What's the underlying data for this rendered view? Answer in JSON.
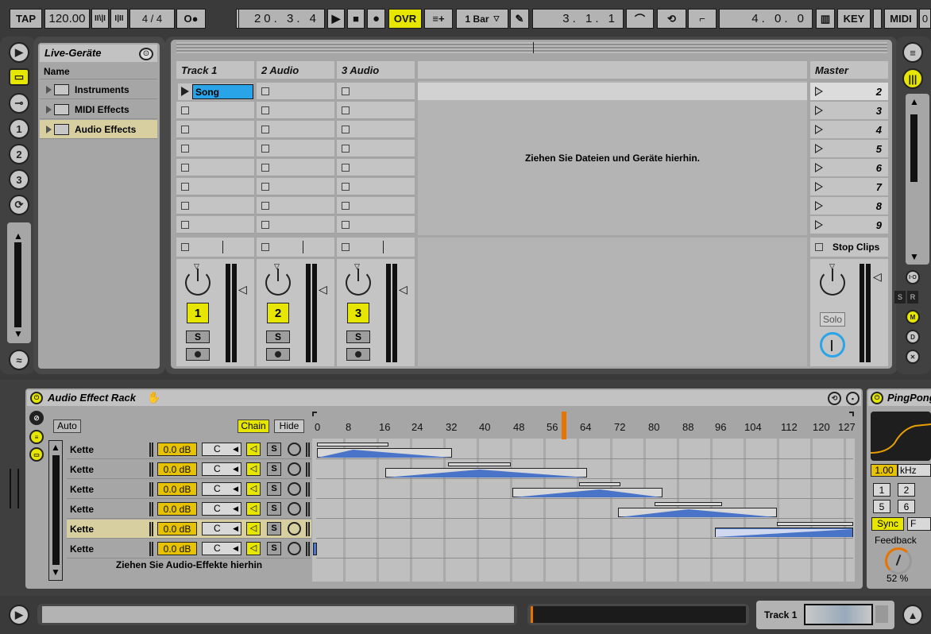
{
  "transport": {
    "tap": "TAP",
    "tempo": "120.00",
    "signature": "4 / 4",
    "position": "20.  3.  4",
    "ovr": "OVR",
    "quantize": "1 Bar",
    "loop_start": "3.  1.  1",
    "loop_length": "4.  0.  0",
    "key": "KEY",
    "midi": "MIDI",
    "extra": "0"
  },
  "browser": {
    "title": "Live-Geräte",
    "column": "Name",
    "items": [
      {
        "label": "Instruments"
      },
      {
        "label": "MIDI Effects"
      },
      {
        "label": "Audio Effects"
      }
    ]
  },
  "session": {
    "tracks": [
      {
        "name": "Track 1",
        "number": "1",
        "clip": "Song"
      },
      {
        "name": "2 Audio",
        "number": "2"
      },
      {
        "name": "3 Audio",
        "number": "3"
      }
    ],
    "drop_hint": "Ziehen Sie Dateien und Geräte hierhin.",
    "master": {
      "name": "Master",
      "scenes": [
        "2",
        "3",
        "4",
        "5",
        "6",
        "7",
        "8",
        "9"
      ],
      "stop_clips": "Stop Clips",
      "solo": "Solo"
    },
    "solo_label": "S"
  },
  "rack": {
    "title": "Audio Effect Rack",
    "auto": "Auto",
    "chain": "Chain",
    "hide": "Hide",
    "ruler": [
      "0",
      "8",
      "16",
      "24",
      "32",
      "40",
      "48",
      "56",
      "64",
      "72",
      "80",
      "88",
      "96",
      "104",
      "112",
      "120",
      "127"
    ],
    "chains": [
      {
        "name": "Kette",
        "volume": "0.0 dB",
        "pan": "C",
        "selected": false
      },
      {
        "name": "Kette",
        "volume": "0.0 dB",
        "pan": "C",
        "selected": false
      },
      {
        "name": "Kette",
        "volume": "0.0 dB",
        "pan": "C",
        "selected": false
      },
      {
        "name": "Kette",
        "volume": "0.0 dB",
        "pan": "C",
        "selected": false
      },
      {
        "name": "Kette",
        "volume": "0.0 dB",
        "pan": "C",
        "selected": true
      },
      {
        "name": "Kette",
        "volume": "0.0 dB",
        "pan": "C",
        "selected": false
      }
    ],
    "drop_hint": "Ziehen Sie Audio-Effekte hierhin",
    "solo_label": "S"
  },
  "pingpong": {
    "title": "PingPong",
    "freq": "1.00",
    "freq_unit": "kHz",
    "beats": [
      "1",
      "2",
      "5",
      "6"
    ],
    "sync": "Sync",
    "feedback_label": "Feedback",
    "feedback": "52 %"
  },
  "status": {
    "track": "Track 1"
  },
  "colors": {
    "accent": "#e6e600",
    "clip_selected": "#2aa4e8",
    "zone_blue": "#4a74c8",
    "orange_marker": "#e87400"
  }
}
